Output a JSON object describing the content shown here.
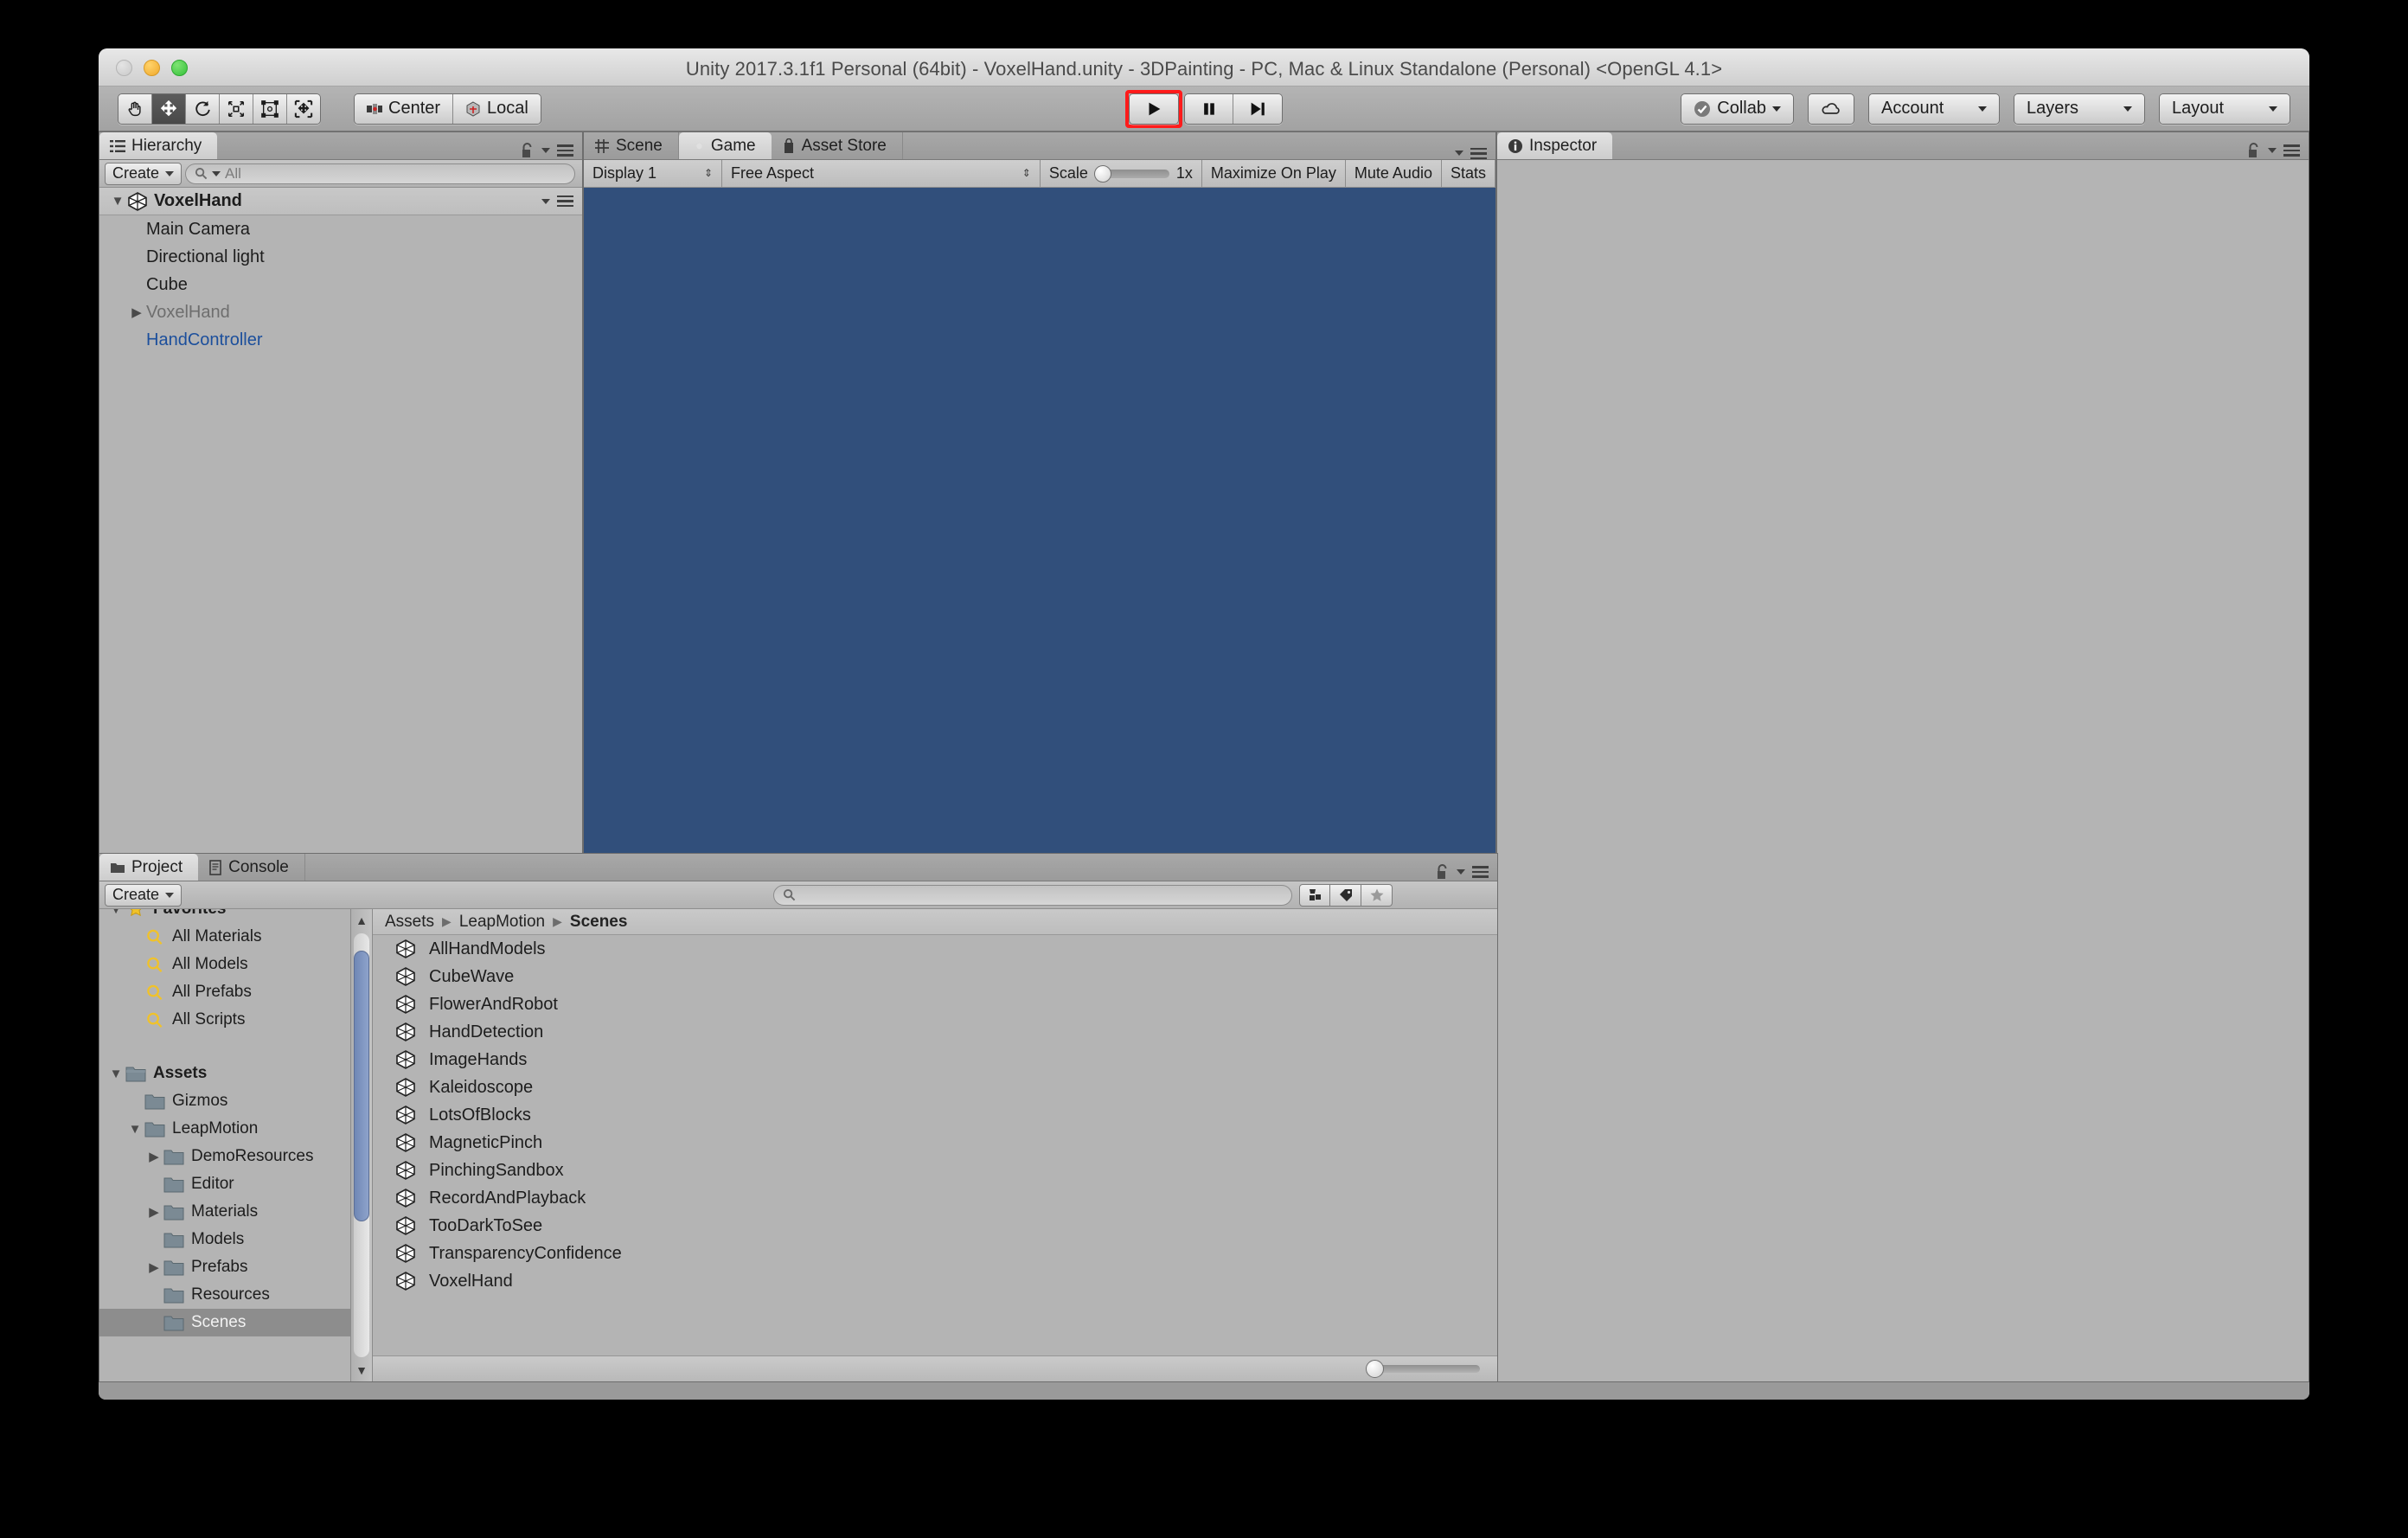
{
  "window": {
    "title": "Unity 2017.3.1f1 Personal (64bit) - VoxelHand.unity - 3DPainting - PC, Mac & Linux Standalone (Personal) <OpenGL 4.1>",
    "traffic_lights": [
      "close-button",
      "minimize-button",
      "maximize-button"
    ]
  },
  "toolbar": {
    "transform_tools": [
      {
        "name": "hand-tool",
        "selected": false
      },
      {
        "name": "move-tool",
        "selected": true
      },
      {
        "name": "rotate-tool",
        "selected": false
      },
      {
        "name": "scale-tool",
        "selected": false
      },
      {
        "name": "rect-tool",
        "selected": false
      },
      {
        "name": "transform-tool",
        "selected": false
      }
    ],
    "pivot_mode": "Center",
    "pivot_rotation": "Local",
    "playback": {
      "play": "play-button",
      "pause": "pause-button",
      "step": "step-button",
      "highlighted": "play"
    },
    "collab_label": "Collab",
    "cloud_label": "cloud-button",
    "account_label": "Account",
    "layers_label": "Layers",
    "layout_label": "Layout"
  },
  "hierarchy": {
    "tab_label": "Hierarchy",
    "create_label": "Create",
    "search_placeholder": "All",
    "scene_name": "VoxelHand",
    "items": [
      {
        "label": "Main Camera",
        "style": "normal",
        "expandable": false
      },
      {
        "label": "Directional light",
        "style": "normal",
        "expandable": false
      },
      {
        "label": "Cube",
        "style": "normal",
        "expandable": false
      },
      {
        "label": "VoxelHand",
        "style": "dim",
        "expandable": true
      },
      {
        "label": "HandController",
        "style": "prefab",
        "expandable": false
      }
    ]
  },
  "center": {
    "tabs": [
      {
        "label": "Scene",
        "icon": "grid-icon",
        "selected": false
      },
      {
        "label": "Game",
        "icon": "gamepad-icon",
        "selected": true
      },
      {
        "label": "Asset Store",
        "icon": "store-icon",
        "selected": false
      }
    ],
    "game_toolbar": {
      "display": "Display 1",
      "aspect": "Free Aspect",
      "scale_label": "Scale",
      "scale_value": "1x",
      "maximize_on_play": "Maximize On Play",
      "mute_audio": "Mute Audio",
      "stats": "Stats"
    },
    "viewport_color": "#314f7b"
  },
  "inspector": {
    "tab_label": "Inspector"
  },
  "project": {
    "tabs": [
      {
        "label": "Project",
        "icon": "folder-icon",
        "selected": true
      },
      {
        "label": "Console",
        "icon": "console-icon",
        "selected": false
      }
    ],
    "create_label": "Create",
    "search_placeholder": "",
    "filter_icons": [
      "type-filter-icon",
      "label-filter-icon",
      "favorite-filter-icon"
    ],
    "tree": [
      {
        "label": "Favorites",
        "type": "favorites-root",
        "depth": 0,
        "bold": true,
        "expanded": true,
        "selected": false
      },
      {
        "label": "All Materials",
        "type": "saved-search",
        "depth": 1,
        "bold": false,
        "selected": false
      },
      {
        "label": "All Models",
        "type": "saved-search",
        "depth": 1,
        "bold": false,
        "selected": false
      },
      {
        "label": "All Prefabs",
        "type": "saved-search",
        "depth": 1,
        "bold": false,
        "selected": false
      },
      {
        "label": "All Scripts",
        "type": "saved-search",
        "depth": 1,
        "bold": false,
        "selected": false
      },
      {
        "label": "",
        "type": "spacer",
        "depth": 0,
        "bold": false,
        "selected": false
      },
      {
        "label": "Assets",
        "type": "folder",
        "depth": 0,
        "bold": true,
        "expanded": true,
        "selected": false
      },
      {
        "label": "Gizmos",
        "type": "folder",
        "depth": 1,
        "bold": false,
        "selected": false
      },
      {
        "label": "LeapMotion",
        "type": "folder",
        "depth": 1,
        "bold": false,
        "expanded": true,
        "selected": false
      },
      {
        "label": "DemoResources",
        "type": "folder",
        "depth": 2,
        "bold": false,
        "expandable": true,
        "selected": false
      },
      {
        "label": "Editor",
        "type": "folder",
        "depth": 2,
        "bold": false,
        "selected": false
      },
      {
        "label": "Materials",
        "type": "folder",
        "depth": 2,
        "bold": false,
        "expandable": true,
        "selected": false
      },
      {
        "label": "Models",
        "type": "folder",
        "depth": 2,
        "bold": false,
        "selected": false
      },
      {
        "label": "Prefabs",
        "type": "folder",
        "depth": 2,
        "bold": false,
        "expandable": true,
        "selected": false
      },
      {
        "label": "Resources",
        "type": "folder",
        "depth": 2,
        "bold": false,
        "selected": false
      },
      {
        "label": "Scenes",
        "type": "folder",
        "depth": 2,
        "bold": false,
        "selected": true
      }
    ],
    "breadcrumb": [
      "Assets",
      "LeapMotion",
      "Scenes"
    ],
    "assets": [
      "AllHandModels",
      "CubeWave",
      "FlowerAndRobot",
      "HandDetection",
      "ImageHands",
      "Kaleidoscope",
      "LotsOfBlocks",
      "MagneticPinch",
      "PinchingSandbox",
      "RecordAndPlayback",
      "TooDarkToSee",
      "TransparencyConfidence",
      "VoxelHand"
    ]
  },
  "colors": {
    "accent_highlight": "#ff1b1b",
    "game_background": "#314f7b",
    "prefab_blue": "#1c4f9c",
    "scrollbar_blue": "#7f96c2"
  }
}
